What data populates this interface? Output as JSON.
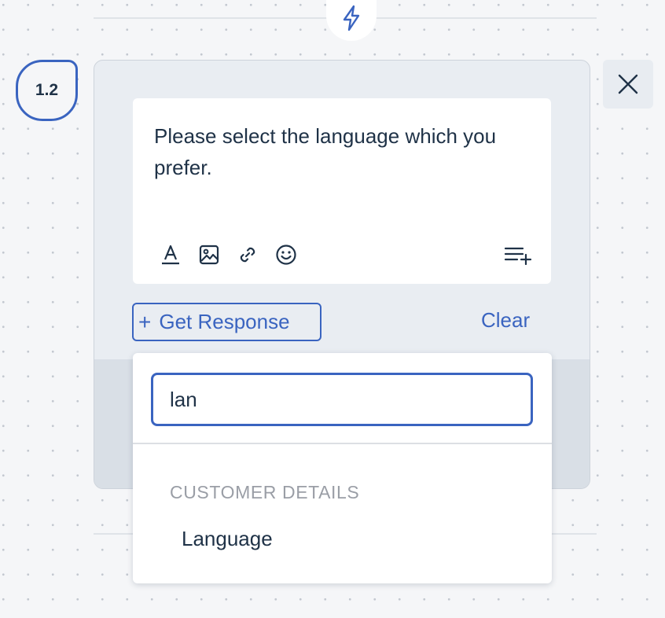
{
  "step": {
    "badge": "1.2"
  },
  "message": {
    "text": "Please select the language which you prefer."
  },
  "toolbar": {
    "icons": [
      "text-format-icon",
      "image-icon",
      "link-icon",
      "emoji-icon",
      "add-list-icon"
    ]
  },
  "actions": {
    "get_response_plus": "+",
    "get_response_label": "Get Response",
    "clear_label": "Clear"
  },
  "search": {
    "value": "lan"
  },
  "results": {
    "group_label": "CUSTOMER DETAILS",
    "items": [
      {
        "label": "Language"
      }
    ]
  },
  "colors": {
    "accent": "#3a64c0",
    "text": "#1f3247",
    "muted": "#9a9ea6",
    "card_bg": "#e9edf2"
  }
}
